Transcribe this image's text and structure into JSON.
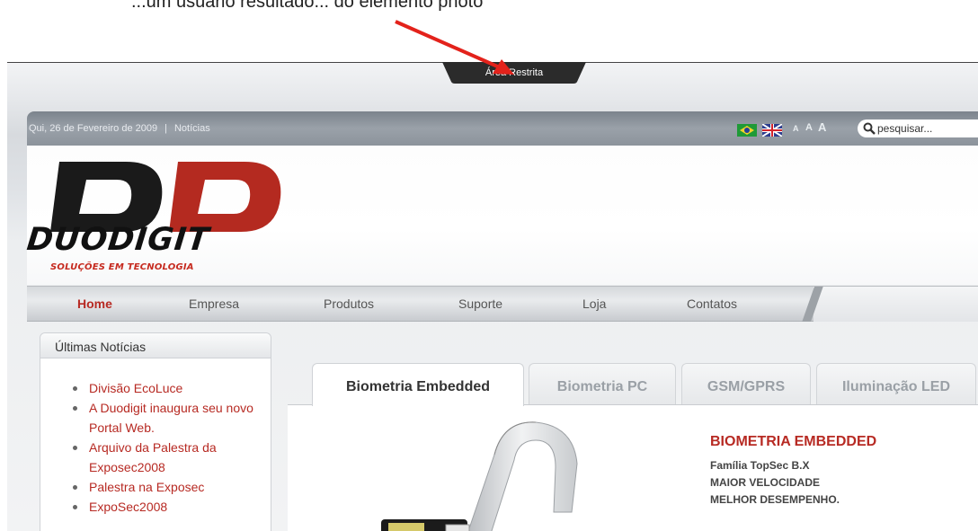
{
  "page_caption": "...um usuário resultado... do elemento photo",
  "restricted_area": {
    "label": "Área Restrita"
  },
  "topbar": {
    "date": "Qui, 26 de Fevereiro de 2009",
    "separator": "|",
    "news_link": "Notícias",
    "font_sizes": [
      "A",
      "A",
      "A"
    ],
    "search": {
      "placeholder": "pesquisar..."
    }
  },
  "logo": {
    "brand": "DUODIGIT",
    "tagline": "SOLUÇÕES EM TECNOLOGIA",
    "colors": {
      "black": "#1a1a1a",
      "red": "#b42a20"
    }
  },
  "nav": {
    "items": [
      {
        "label": "Home",
        "active": true
      },
      {
        "label": "Empresa",
        "active": false
      },
      {
        "label": "Produtos",
        "active": false
      },
      {
        "label": "Suporte",
        "active": false
      },
      {
        "label": "Loja",
        "active": false
      },
      {
        "label": "Contatos",
        "active": false
      }
    ]
  },
  "news": {
    "title": "Últimas Notícias",
    "items": [
      "Divisão EcoLuce",
      "A Duodigit inaugura seu novo Portal Web.",
      "Arquivo da Palestra da Exposec2008",
      "Palestra na Exposec",
      "ExpoSec2008"
    ]
  },
  "tabs": [
    {
      "label": "Biometria Embedded",
      "active": true
    },
    {
      "label": "Biometria PC",
      "active": false
    },
    {
      "label": "GSM/GPRS",
      "active": false
    },
    {
      "label": "Iluminação LED",
      "active": false
    }
  ],
  "product": {
    "title": "BIOMETRIA EMBEDDED",
    "lines": [
      "Família TopSec B.X",
      "MAIOR VELOCIDADE",
      "MELHOR DESEMPENHO."
    ]
  },
  "accent_color": "#b72a23"
}
